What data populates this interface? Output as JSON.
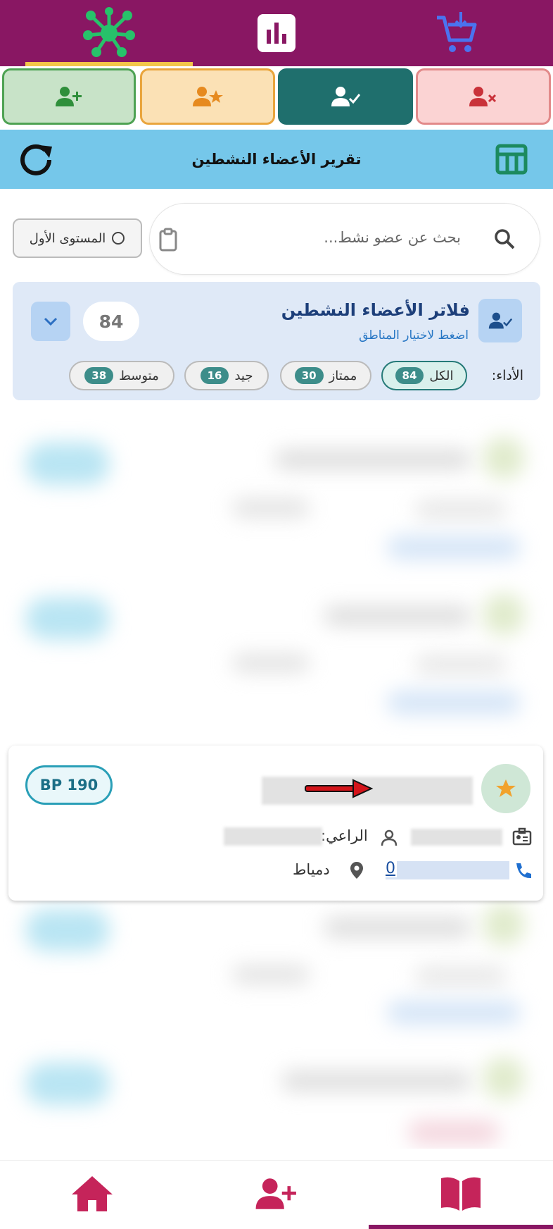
{
  "header": {
    "title": "تقرير الأعضاء النشطين"
  },
  "search": {
    "placeholder": "بحث عن عضو نشط...",
    "level_label": "المستوى الأول"
  },
  "filter": {
    "title": "فلاتر الأعضاء النشطين",
    "subtitle": "اضغط لاختيار المناطق",
    "count": "84",
    "performance_label": "الأداء:",
    "chips": [
      {
        "label": "الكل",
        "count": "84"
      },
      {
        "label": "ممتاز",
        "count": "30"
      },
      {
        "label": "جيد",
        "count": "16"
      },
      {
        "label": "متوسط",
        "count": "38"
      }
    ]
  },
  "member_card": {
    "bp": "BP 190",
    "sponsor_label": "الراعي:",
    "phone_prefix": "0",
    "city": "دمياط"
  },
  "colors": {
    "brand": "#891763",
    "accent": "#f3c64a",
    "header": "#75c7ea",
    "teal": "#267a78"
  },
  "icons": {
    "top_tabs": [
      "network-icon",
      "bar-chart-icon",
      "cart-icon"
    ],
    "subtabs": [
      "add-user-icon",
      "user-star-icon",
      "user-check-icon",
      "user-remove-icon"
    ],
    "bottom": [
      "home-icon",
      "add-user-icon",
      "book-icon"
    ]
  }
}
